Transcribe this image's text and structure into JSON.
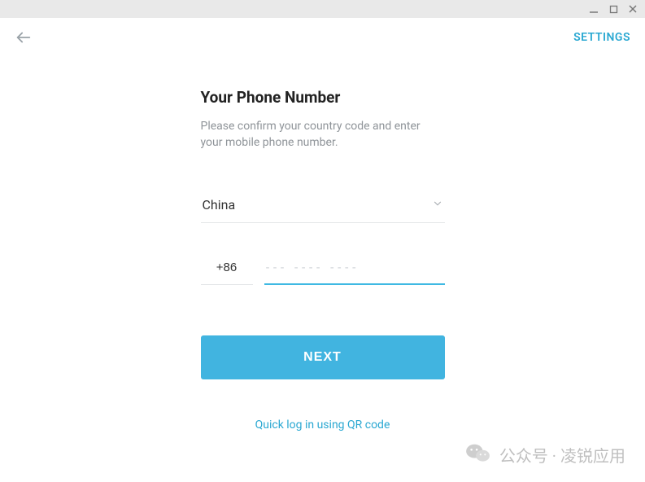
{
  "header": {
    "settings_label": "SETTINGS"
  },
  "form": {
    "title": "Your Phone Number",
    "subtitle": "Please confirm your country code and enter your mobile phone number.",
    "country_selected": "China",
    "country_code": "+86",
    "phone_value": "",
    "phone_placeholder": "--- ---- ----",
    "next_label": "NEXT",
    "qr_link_label": "Quick log in using QR code"
  },
  "watermark": {
    "text": "公众号 · 凌锐应用"
  }
}
